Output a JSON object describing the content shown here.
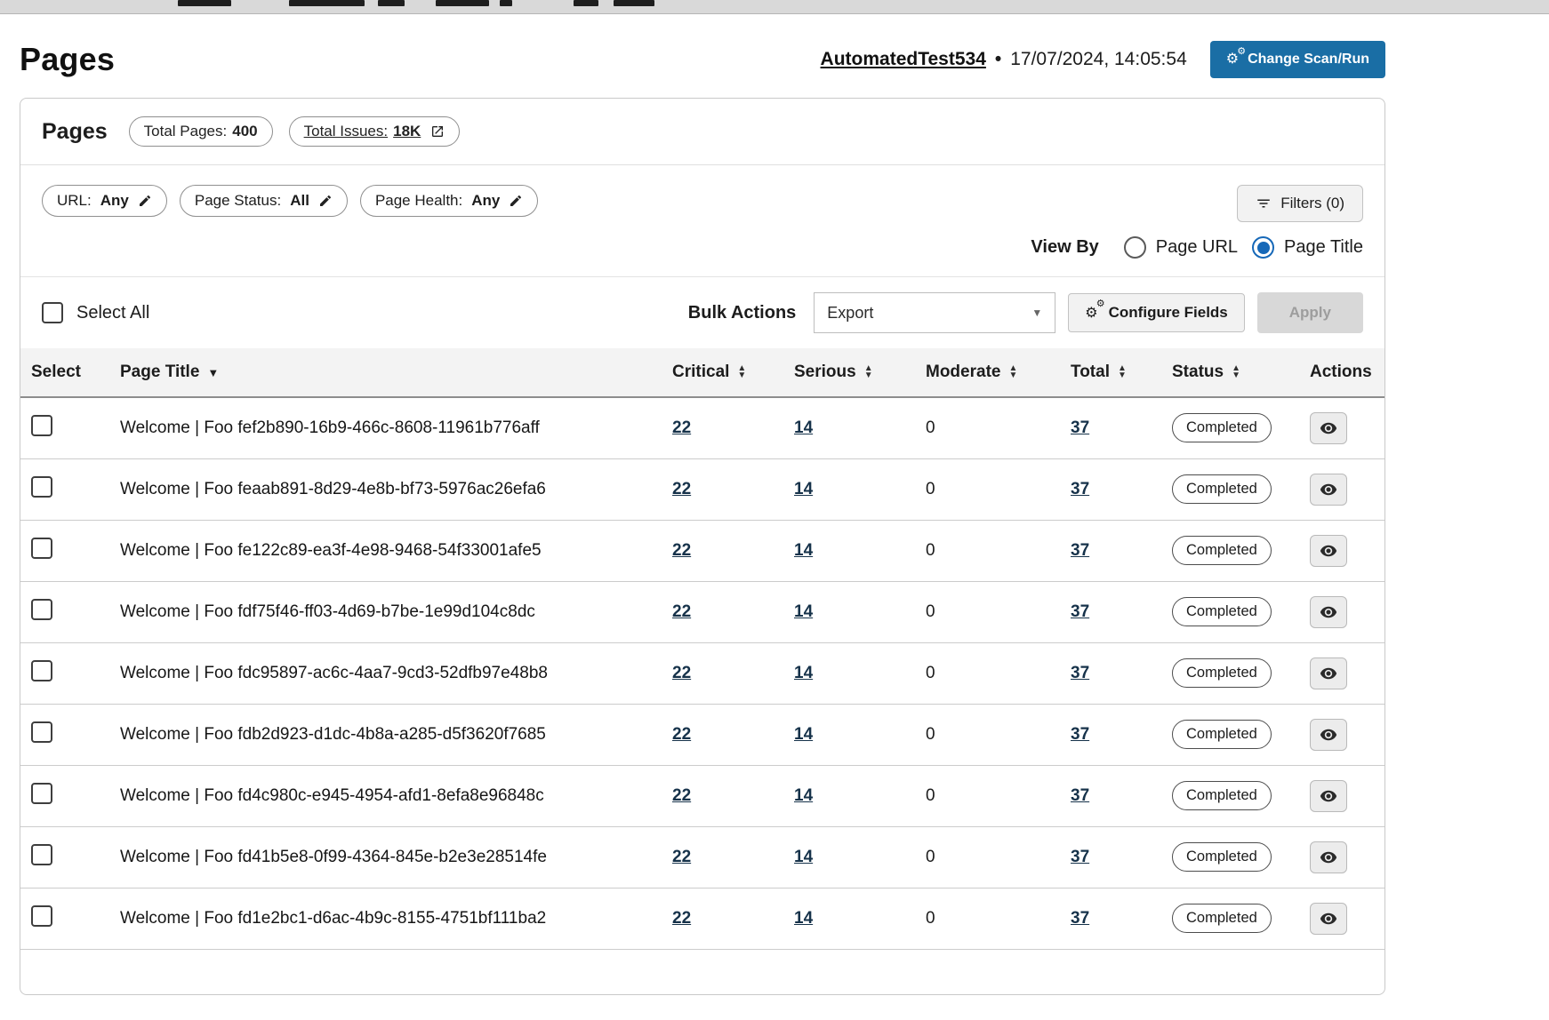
{
  "header": {
    "page_title": "Pages",
    "scan_name": "AutomatedTest534",
    "separator": "•",
    "timestamp": "17/07/2024, 14:05:54",
    "change_scan_button": "Change Scan/Run"
  },
  "panel": {
    "title": "Pages",
    "total_pages": {
      "label": "Total Pages:",
      "value": "400"
    },
    "total_issues": {
      "label": "Total Issues:",
      "value": "18K"
    },
    "filter_chips": [
      {
        "label": "URL:",
        "value": "Any"
      },
      {
        "label": "Page Status:",
        "value": "All"
      },
      {
        "label": "Page Health:",
        "value": "Any"
      }
    ],
    "filters_button": "Filters (0)",
    "view_by": {
      "label": "View By",
      "options": [
        {
          "label": "Page URL",
          "selected": false
        },
        {
          "label": "Page Title",
          "selected": true
        }
      ]
    },
    "select_all": "Select All",
    "bulk_actions_label": "Bulk Actions",
    "bulk_action_value": "Export",
    "configure_fields_button": "Configure Fields",
    "apply_button": "Apply"
  },
  "table": {
    "headers": {
      "select": "Select",
      "page_title": "Page Title",
      "critical": "Critical",
      "serious": "Serious",
      "moderate": "Moderate",
      "total": "Total",
      "status": "Status",
      "actions": "Actions"
    },
    "rows": [
      {
        "title": "Welcome | Foo fef2b890-16b9-466c-8608-11961b776aff",
        "critical": "22",
        "serious": "14",
        "moderate": "0",
        "total": "37",
        "status": "Completed"
      },
      {
        "title": "Welcome | Foo feaab891-8d29-4e8b-bf73-5976ac26efa6",
        "critical": "22",
        "serious": "14",
        "moderate": "0",
        "total": "37",
        "status": "Completed"
      },
      {
        "title": "Welcome | Foo fe122c89-ea3f-4e98-9468-54f33001afe5",
        "critical": "22",
        "serious": "14",
        "moderate": "0",
        "total": "37",
        "status": "Completed"
      },
      {
        "title": "Welcome | Foo fdf75f46-ff03-4d69-b7be-1e99d104c8dc",
        "critical": "22",
        "serious": "14",
        "moderate": "0",
        "total": "37",
        "status": "Completed"
      },
      {
        "title": "Welcome | Foo fdc95897-ac6c-4aa7-9cd3-52dfb97e48b8",
        "critical": "22",
        "serious": "14",
        "moderate": "0",
        "total": "37",
        "status": "Completed"
      },
      {
        "title": "Welcome | Foo fdb2d923-d1dc-4b8a-a285-d5f3620f7685",
        "critical": "22",
        "serious": "14",
        "moderate": "0",
        "total": "37",
        "status": "Completed"
      },
      {
        "title": "Welcome | Foo fd4c980c-e945-4954-afd1-8efa8e96848c",
        "critical": "22",
        "serious": "14",
        "moderate": "0",
        "total": "37",
        "status": "Completed"
      },
      {
        "title": "Welcome | Foo fd41b5e8-0f99-4364-845e-b2e3e28514fe",
        "critical": "22",
        "serious": "14",
        "moderate": "0",
        "total": "37",
        "status": "Completed"
      },
      {
        "title": "Welcome | Foo fd1e2bc1-d6ac-4b9c-8155-4751bf111ba2",
        "critical": "22",
        "serious": "14",
        "moderate": "0",
        "total": "37",
        "status": "Completed"
      }
    ]
  },
  "icons": {
    "gear": "⚙",
    "sort_up": "▲",
    "sort_down": "▼",
    "sorted_desc": "▼",
    "select_caret": "▼"
  },
  "colors": {
    "accent_blue": "#1a6ea5",
    "radio_blue": "#1668b8",
    "header_cell_blue": "#b4d2e9",
    "header_row_bg": "#f3f3f3",
    "link_color": "#16324a",
    "row_border": "#cccccc",
    "pill_border": "#8f8f8f",
    "button_gray_bg": "#f2f2f2",
    "disabled_bg": "#d8d8d8",
    "disabled_text": "#9d9d9d",
    "topstrip_bg": "#d9d9d9"
  }
}
